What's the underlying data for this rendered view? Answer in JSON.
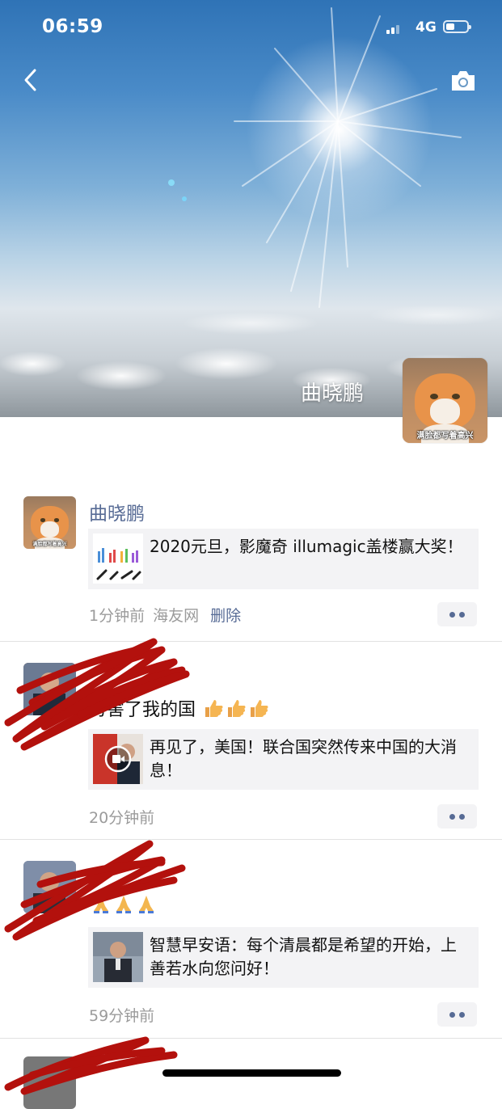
{
  "status_bar": {
    "time": "06:59",
    "network": "4G"
  },
  "cover": {
    "owner_name": "曲晓鹏",
    "avatar_caption": "满脸都写着高兴"
  },
  "icons": {
    "back": "chevron-left-icon",
    "camera": "camera-icon",
    "more": "more-dots-icon",
    "video": "video-play-icon",
    "thumbs_up": "thumbs-up-emoji",
    "pray": "pray-emoji"
  },
  "posts": [
    {
      "author": "曲晓鹏",
      "avatar_caption": "满脸都写着高兴",
      "link_title": "2020元旦，影魔奇 illumagic盖楼赢大奖！",
      "time": "1分钟前",
      "source": "海友网",
      "delete_label": "删除"
    },
    {
      "text": "厉害了我的国",
      "link_title": "再见了，美国！联合国突然传来中国的大消息！",
      "time": "20分钟前"
    },
    {
      "link_title": "智慧早安语：每个清晨都是希望的开始，上善若水向您问好！",
      "time": "59分钟前"
    }
  ],
  "colors": {
    "link_blue": "#576b95",
    "meta_gray": "#9b9b9b",
    "card_bg": "#f3f3f5",
    "scribble_red": "#b3110d"
  }
}
